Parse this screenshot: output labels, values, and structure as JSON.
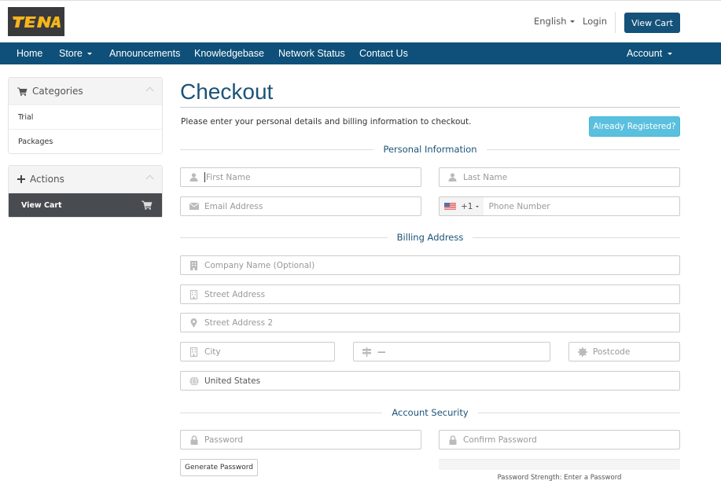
{
  "header": {
    "logo_text": "TENA",
    "language": "English",
    "login": "Login",
    "view_cart": "View Cart"
  },
  "nav": {
    "items": [
      {
        "label": "Home",
        "dropdown": false
      },
      {
        "label": "Store",
        "dropdown": true
      },
      {
        "label": "Announcements",
        "dropdown": false
      },
      {
        "label": "Knowledgebase",
        "dropdown": false
      },
      {
        "label": "Network Status",
        "dropdown": false
      },
      {
        "label": "Contact Us",
        "dropdown": false
      }
    ],
    "account": "Account"
  },
  "sidebar": {
    "categories": {
      "title": "Categories",
      "icon": "cart-icon",
      "items": [
        {
          "label": "Trial"
        },
        {
          "label": "Packages"
        }
      ]
    },
    "actions": {
      "title": "Actions",
      "icon": "plus-icon",
      "items": [
        {
          "label": "View Cart",
          "icon": "cart-icon",
          "active": true
        }
      ]
    }
  },
  "main": {
    "title": "Checkout",
    "intro": "Please enter your personal details and billing information to checkout.",
    "already_registered": "Already Registered?",
    "sections": {
      "personal": "Personal Information",
      "billing": "Billing Address",
      "security": "Account Security"
    },
    "fields": {
      "first_name": {
        "placeholder": "First Name",
        "icon": "user-icon"
      },
      "last_name": {
        "placeholder": "Last Name",
        "icon": "user-icon"
      },
      "email": {
        "placeholder": "Email Address",
        "icon": "envelope-icon"
      },
      "phone": {
        "placeholder": "Phone Number",
        "country_code": "+1",
        "flag": "us-flag-icon"
      },
      "company": {
        "placeholder": "Company Name (Optional)",
        "icon": "building-icon"
      },
      "street": {
        "placeholder": "Street Address",
        "icon": "building-outline-icon"
      },
      "street2": {
        "placeholder": "Street Address 2",
        "icon": "map-marker-icon"
      },
      "city": {
        "placeholder": "City",
        "icon": "building-outline-icon"
      },
      "state": {
        "value": "—",
        "icon": "signpost-icon"
      },
      "postcode": {
        "placeholder": "Postcode",
        "icon": "certificate-icon"
      },
      "country": {
        "value": "United States",
        "icon": "globe-icon"
      },
      "password": {
        "placeholder": "Password",
        "icon": "lock-icon"
      },
      "confirm_password": {
        "placeholder": "Confirm Password",
        "icon": "lock-icon"
      }
    },
    "generate_password": "Generate Password",
    "password_strength": {
      "text": "Password Strength: Enter a Password",
      "percent": 0
    }
  },
  "colors": {
    "brand": "#0e5079",
    "button_primary": "#14527a",
    "button_info": "#5bc0de",
    "heading": "#1c5378",
    "sidebar_active": "#484c50",
    "logo_yellow": "#f5b51b"
  }
}
